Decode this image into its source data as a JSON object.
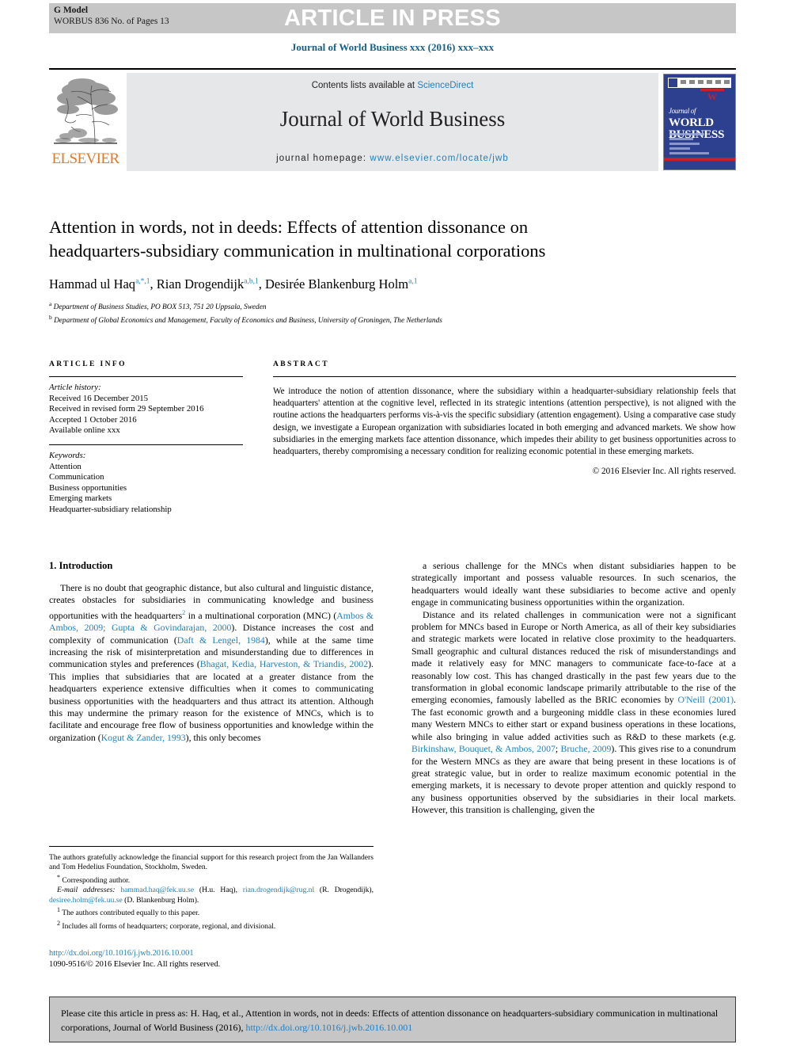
{
  "banner": {
    "g_model_label": "G Model",
    "g_model_value": "WORBUS 836 No. of Pages 13",
    "press_title": "ARTICLE IN PRESS"
  },
  "running_head": "Journal of World Business xxx (2016) xxx–xxx",
  "masthead": {
    "contents_prefix": "Contents lists available at ",
    "contents_link": "ScienceDirect",
    "journal_name": "Journal of World Business",
    "homepage_prefix": "journal homepage: ",
    "homepage_url": "www.elsevier.com/locate/jwb",
    "publisher": "ELSEVIER",
    "cover_title_small": "Journal of",
    "cover_title_1": "WORLD",
    "cover_title_2": "BUSINESS",
    "accent_link_color": "#1f7fc1",
    "publisher_color": "#e87722",
    "cover_bg": "#2d3f8f",
    "cover_accent": "#c9202c"
  },
  "article": {
    "title": "Attention in words, not in deeds: Effects of attention dissonance on headquarters-subsidiary communication in multinational corporations",
    "authors_html": "Hammad ul Haq<sup>a,*,1</sup>, Rian Drogendijk<sup>a,b,1</sup>, Desirée Blankenburg Holm<sup>a,1</sup>",
    "affiliation_a": "Department of Business Studies, PO BOX 513, 751 20 Uppsala, Sweden",
    "affiliation_b": "Department of Global Economics and Management, Faculty of Economics and Business, University of Groningen, The Netherlands"
  },
  "info": {
    "heading": "ARTICLE INFO",
    "history_label": "Article history:",
    "history": [
      "Received 16 December 2015",
      "Received in revised form 29 September 2016",
      "Accepted 1 October 2016",
      "Available online xxx"
    ],
    "keywords_label": "Keywords:",
    "keywords": [
      "Attention",
      "Communication",
      "Business opportunities",
      "Emerging markets",
      "Headquarter-subsidiary relationship"
    ]
  },
  "abstract": {
    "heading": "ABSTRACT",
    "text": "We introduce the notion of attention dissonance, where the subsidiary within a headquarter-subsidiary relationship feels that headquarters' attention at the cognitive level, reflected in its strategic intentions (attention perspective), is not aligned with the routine actions the headquarters performs vis-à-vis the specific subsidiary (attention engagement). Using a comparative case study design, we investigate a European organization with subsidiaries located in both emerging and advanced markets. We show how subsidiaries in the emerging markets face attention dissonance, which impedes their ability to get business opportunities across to headquarters, thereby compromising a necessary condition for realizing economic potential in these emerging markets.",
    "copyright": "© 2016 Elsevier Inc. All rights reserved."
  },
  "body": {
    "section_heading": "1. Introduction",
    "left_paragraph_1_html": "There is no doubt that geographic distance, but also cultural and linguistic distance, creates obstacles for subsidiaries in communicating knowledge and business opportunities with the headquarters<sup>2</sup> in a multinational corporation (MNC) (<span class=\"ref\">Ambos &amp; Ambos, 2009; Gupta &amp; Govindarajan, 2000</span>). Distance increases the cost and complexity of communication (<span class=\"ref\">Daft &amp; Lengel, 1984</span>), while at the same time increasing the risk of misinterpretation and misunderstanding due to differences in communication styles and preferences (<span class=\"ref\">Bhagat, Kedia, Harveston, &amp; Triandis, 2002</span>). This implies that subsidiaries that are located at a greater distance from the headquarters experience extensive difficulties when it comes to communicating business opportunities with the headquarters and thus attract its attention. Although this may undermine the primary reason for the existence of MNCs, which is to facilitate and encourage free flow of business opportunities and knowledge within the organization (<span class=\"ref\">Kogut &amp; Zander, 1993</span>), this only becomes",
    "right_paragraph_1_html": "a serious challenge for the MNCs when distant subsidiaries happen to be strategically important and possess valuable resources. In such scenarios, the headquarters would ideally want these subsidiaries to become active and openly engage in communicating business opportunities within the organization.",
    "right_paragraph_2_html": "Distance and its related challenges in communication were not a significant problem for MNCs based in Europe or North America, as all of their key subsidiaries and strategic markets were located in relative close proximity to the headquarters. Small geographic and cultural distances reduced the risk of misunderstandings and made it relatively easy for MNC managers to communicate face-to-face at a reasonably low cost. This has changed drastically in the past few years due to the transformation in global economic landscape primarily attributable to the rise of the emerging economies, famously labelled as the BRIC economies by <span class=\"ref\">O'Neill (2001)</span>. The fast economic growth and a burgeoning middle class in these economies lured many Western MNCs to either start or expand business operations in these locations, while also bringing in value added activities such as R&amp;D to these markets (e.g. <span class=\"ref\">Birkinshaw, Bouquet, &amp; Ambos, 2007</span>; <span class=\"ref\">Bruche, 2009</span>). This gives rise to a conundrum for the Western MNCs as they are aware that being present in these locations is of great strategic value, but in order to realize maximum economic potential in the emerging markets, it is necessary to devote proper attention and quickly respond to any business opportunities observed by the subsidiaries in their local markets. However, this transition is challenging, given the"
  },
  "footnotes": {
    "acknowledgement": "The authors gratefully acknowledge the financial support for this research project from the Jan Wallanders and Tom Hedelius Foundation, Stockholm, Sweden.",
    "corresponding": "Corresponding author.",
    "corresponding_mark": "*",
    "email_label": "E-mail addresses:",
    "email_html": "<span class=\"lnk\">hammad.haq@fek.uu.se</span> (H.u. Haq), <span class=\"lnk\">rian.drogendijk@rug.nl</span> (R. Drogendijk), <span class=\"lnk\">desiree.holm@fek.uu.se</span> (D. Blankenburg Holm).",
    "note_1_mark": "1",
    "note_1": "The authors contributed equally to this paper.",
    "note_2_mark": "2",
    "note_2": "Includes all forms of headquarters; corporate, regional, and divisional."
  },
  "doi_block": {
    "doi_url": "http://dx.doi.org/10.1016/j.jwb.2016.10.001",
    "issn_line": "1090-9516/© 2016 Elsevier Inc. All rights reserved."
  },
  "cite_box": {
    "text_html": "Please cite this article in press as: H. Haq, et al., Attention in words, not in deeds: Effects of attention dissonance on headquarters-subsidiary communication in multinational corporations, Journal of World Business (2016), <span class=\"lnk\">http://dx.doi.org/10.1016/j.jwb.2016.10.001</span>"
  }
}
